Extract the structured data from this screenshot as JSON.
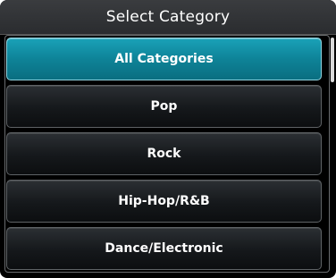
{
  "header": {
    "title": "Select Category"
  },
  "list": {
    "items": [
      {
        "label": "All Categories",
        "selected": true
      },
      {
        "label": "Pop",
        "selected": false
      },
      {
        "label": "Rock",
        "selected": false
      },
      {
        "label": "Hip-Hop/R&B",
        "selected": false
      },
      {
        "label": "Dance/Electronic",
        "selected": false
      }
    ]
  },
  "colors": {
    "selected_accent": "#0e8398",
    "button_background": "#15181b",
    "text": "#ffffff"
  }
}
